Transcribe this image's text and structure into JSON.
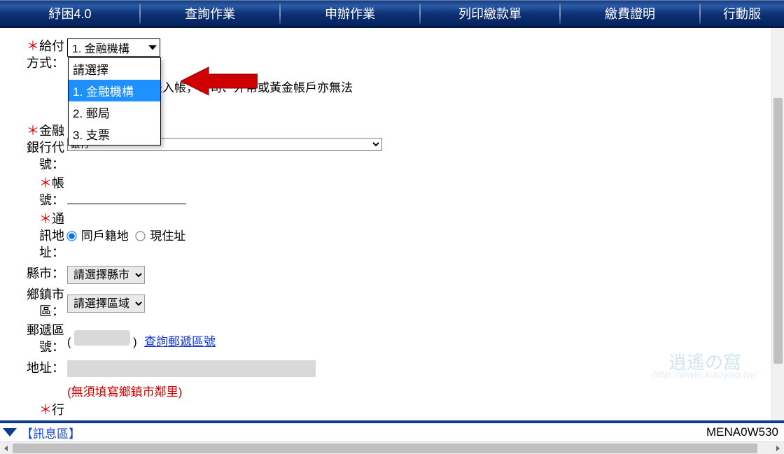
{
  "nav": {
    "items": [
      "紓困4.0",
      "查詢作業",
      "申辦作業",
      "列印繳款單",
      "繳費證明",
      "行動服"
    ]
  },
  "form": {
    "payment_method": {
      "label_pre": "給付",
      "label_post": "方式：",
      "selected": "1. 金融機構",
      "options": [
        "請選擇",
        "1. 金融機構",
        "2. 郵局",
        "3. 支票"
      ],
      "hint": "人」帳戶以免無法入帳，公司、外幣或黃金帳戶亦無法"
    },
    "bank_code": {
      "label_line1": "金融",
      "label_line2": "銀行代",
      "label_line3": "號：",
      "selected_tail": "銀行"
    },
    "account": {
      "label_line1": "帳",
      "label_line2": "號："
    },
    "mailing_addr": {
      "label_line1": "通",
      "label_line2": "訊地",
      "label_line3": "址：",
      "opt1": "同戶籍地",
      "opt2": "現住址"
    },
    "county": {
      "label": "縣市：",
      "placeholder": "請選擇縣市"
    },
    "town": {
      "label_line1": "鄉鎮市",
      "label_line2": "區：",
      "placeholder": "請選擇區域"
    },
    "zip": {
      "label_line1": "郵遞區",
      "label_line2": "號：",
      "link": "查詢郵遞區號",
      "paren_open": "(",
      "paren_close": ")"
    },
    "addr": {
      "label": "地址：",
      "note": "(無須填寫鄉鎮市鄰里)"
    },
    "phone": {
      "label_partial": "行"
    }
  },
  "footer": {
    "msg_label": "【訊息區】",
    "code": "MENA0W530"
  },
  "watermark": {
    "top": "逍遙の窩",
    "url": "http://www.xiaoyao.tw/"
  }
}
